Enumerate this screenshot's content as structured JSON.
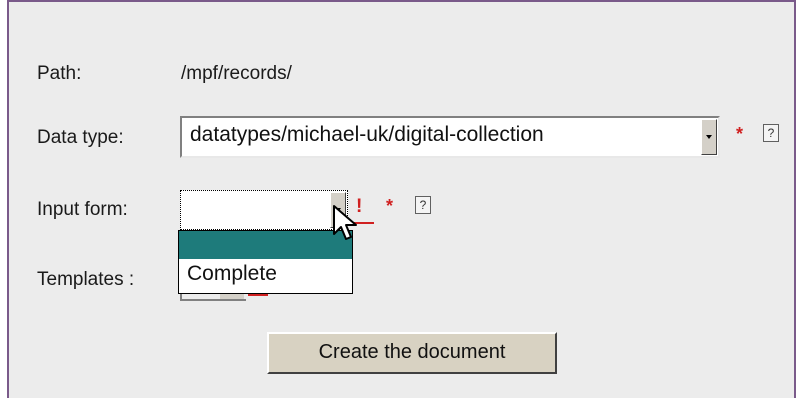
{
  "form": {
    "path_label": "Path:",
    "path_value": "/mpf/records/",
    "datatype_label": "Data type:",
    "datatype_value": "datatypes/michael-uk/digital-collection",
    "inputform_label": "Input form:",
    "inputform_value": "",
    "inputform_options": [
      "",
      "Complete"
    ],
    "templates_label": "Templates :",
    "required_mark": "*",
    "warning_mark": "!",
    "help_mark": "?",
    "submit_label": "Create the document"
  },
  "colors": {
    "panel_bg": "#ececec",
    "panel_border": "#7a5a8a",
    "required": "#d02020",
    "highlight": "#1e7b7b",
    "button_bg": "#d8d2c2"
  },
  "icons": {
    "help": "question-box-icon",
    "dropdown": "chevron-down-icon",
    "cursor": "mouse-pointer-icon"
  }
}
